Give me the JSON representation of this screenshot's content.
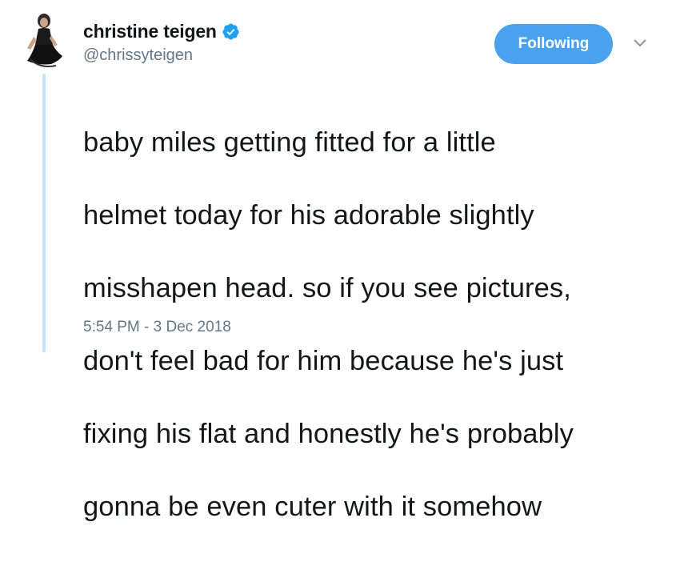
{
  "user": {
    "display_name": "christine teigen",
    "handle": "@chrissyteigen",
    "verified": true,
    "avatar_icon": "profile-photo"
  },
  "actions": {
    "follow_label": "Following",
    "more_icon": "chevron-down-icon"
  },
  "tweet": {
    "text_lines": [
      "baby miles getting fitted for a little",
      "helmet today for his adorable slightly",
      "misshapen head. so if you see pictures,",
      "don't feel bad for him because he's just",
      "fixing his flat and honestly he's probably",
      "gonna be even cuter with it somehow"
    ],
    "timestamp": "5:54 PM - 3 Dec 2018"
  },
  "colors": {
    "accent": "#4aa2ee",
    "thread_line": "#c4e4fb",
    "muted_text": "#657786",
    "text": "#14171a",
    "verified": "#1da1f2"
  }
}
